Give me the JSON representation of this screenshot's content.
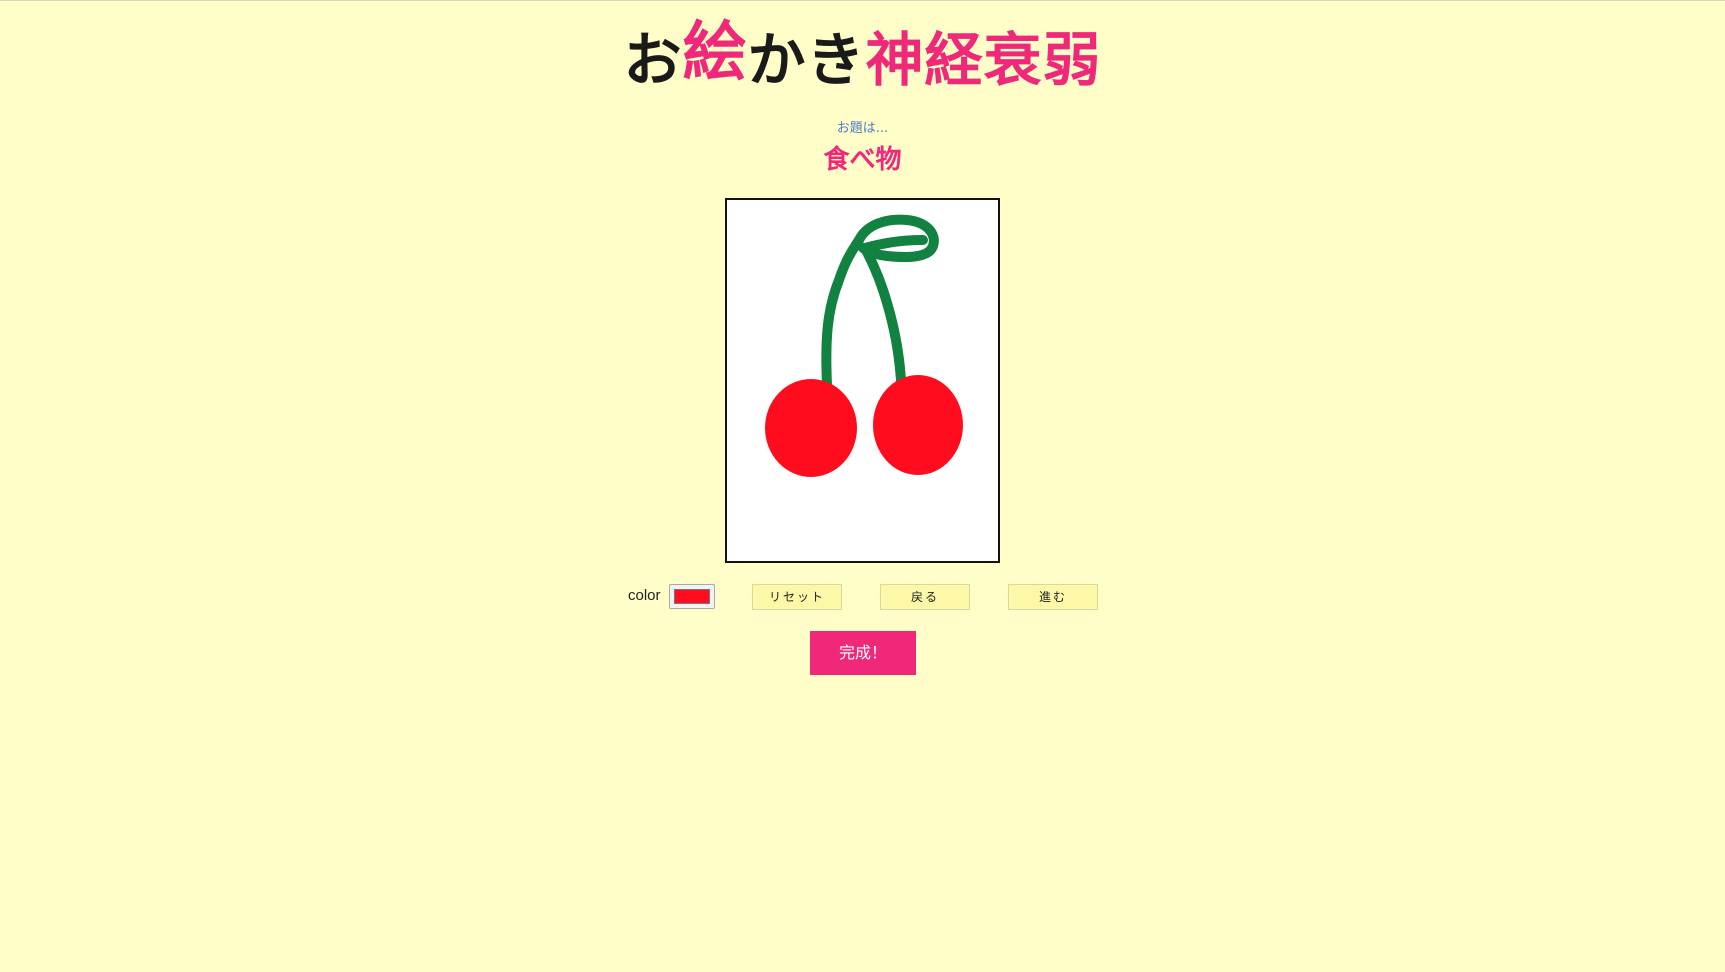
{
  "header": {
    "title_part1": "お",
    "title_part2": "絵",
    "title_part3": "かき",
    "title_part4": "神経衰弱"
  },
  "subject": {
    "label": "お題は...",
    "value": "食べ物"
  },
  "drawing": {
    "stroke_color": "#118240",
    "fill_color": "#ff0d1e",
    "background": "#ffffff"
  },
  "toolbar": {
    "color_label": "color",
    "current_color": "#ff0d1e",
    "reset_label": "リセット",
    "undo_label": "戻る",
    "redo_label": "進む"
  },
  "actions": {
    "done_label": "完成！"
  },
  "colors": {
    "page_background": "#fffdc8",
    "accent": "#f0287a",
    "subject_label": "#4d7ec9",
    "button_background": "#fcf8a8"
  }
}
